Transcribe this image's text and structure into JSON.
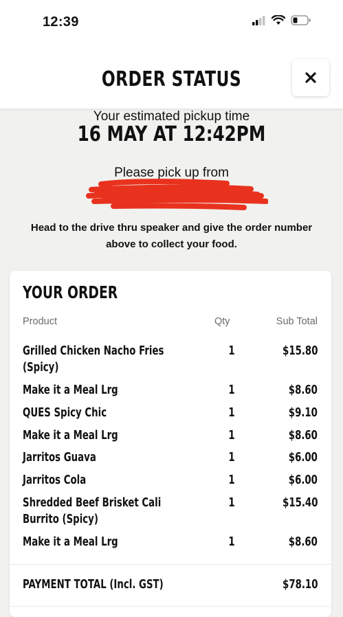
{
  "status_bar": {
    "time": "12:39"
  },
  "header": {
    "title": "ORDER STATUS",
    "close_symbol": "✕"
  },
  "pickup": {
    "label": "Your estimated pickup time",
    "time": "16 MAY AT 12:42PM",
    "from_label": "Please pick up from",
    "instructions": "Head to the drive thru speaker and give the order number above to collect your food."
  },
  "order": {
    "title": "YOUR ORDER",
    "columns": {
      "product": "Product",
      "qty": "Qty",
      "subtotal": "Sub Total"
    },
    "items": [
      {
        "product": "Grilled Chicken Nacho Fries (Spicy)",
        "qty": "1",
        "subtotal": "$15.80"
      },
      {
        "product": "Make it a Meal Lrg",
        "qty": "1",
        "subtotal": "$8.60"
      },
      {
        "product": "QUES Spicy Chic",
        "qty": "1",
        "subtotal": "$9.10"
      },
      {
        "product": "Make it a Meal Lrg",
        "qty": "1",
        "subtotal": "$8.60"
      },
      {
        "product": "Jarritos Guava",
        "qty": "1",
        "subtotal": "$6.00"
      },
      {
        "product": "Jarritos Cola",
        "qty": "1",
        "subtotal": "$6.00"
      },
      {
        "product": "Shredded Beef Brisket Cali Burrito (Spicy)",
        "qty": "1",
        "subtotal": "$15.40"
      },
      {
        "product": "Make it a Meal Lrg",
        "qty": "1",
        "subtotal": "$8.60"
      }
    ],
    "total_label": "PAYMENT TOTAL (Incl. GST)",
    "total_value": "$78.10"
  },
  "colors": {
    "background": "#f1f1ef",
    "redaction": "#e8321e"
  },
  "icons": [
    "signal-icon",
    "wifi-icon",
    "battery-icon",
    "close-icon"
  ]
}
